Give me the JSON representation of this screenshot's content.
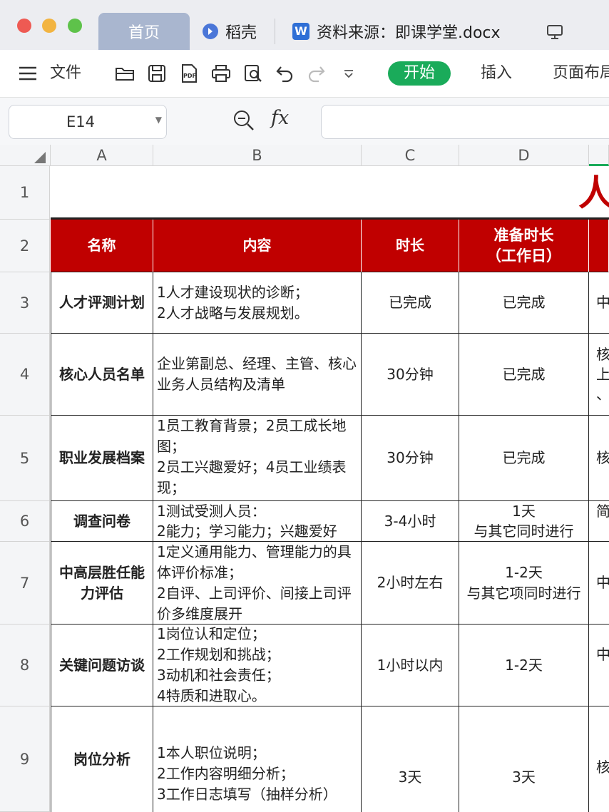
{
  "window": {
    "tabs": [
      {
        "label": "首页",
        "icon": "home"
      },
      {
        "label": "稻壳",
        "icon": "daoke-icon"
      },
      {
        "label": "资料来源：即课学堂.docx",
        "icon": "word-doc-icon"
      }
    ]
  },
  "toolbar": {
    "file_label": "文件",
    "start_label": "开始",
    "insert_label": "插入",
    "layout_label": "页面布局",
    "accent_color": "#1aab5a"
  },
  "formula_bar": {
    "cell_ref": "E14",
    "fx_label": "fx",
    "formula": ""
  },
  "sheet": {
    "columns": [
      "A",
      "B",
      "C",
      "D"
    ],
    "row_numbers": [
      "1",
      "2",
      "3",
      "4",
      "5",
      "6",
      "7",
      "8",
      "9"
    ],
    "title_fragment": "人",
    "header_color": "#c00000",
    "headers": [
      "名称",
      "内容",
      "时长",
      "准备时长\n（工作日）"
    ],
    "rows": [
      {
        "name": "人才评测计划",
        "content": "1人才建设现状的诊断；\n2人才战略与发展规划。",
        "duration": "已完成",
        "prep": "已完成",
        "e": "中"
      },
      {
        "name": "核心人员名单",
        "content": "企业第副总、经理、主管、核心业务人员结构及清单",
        "duration": "30分钟",
        "prep": "已完成",
        "e": "核\n上\n、"
      },
      {
        "name": "职业发展档案",
        "content": "1员工教育背景；2员工成长地图；\n2员工兴趣爱好；4员工业绩表现；",
        "duration": "30分钟",
        "prep": "已完成",
        "e": "核"
      },
      {
        "name": "调查问卷",
        "content": "1测试受测人员：\n2能力；学习能力；兴趣爱好",
        "duration": "3-4小时",
        "prep": "1天\n与其它同时进行",
        "e": "简"
      },
      {
        "name": "中高层胜任能力评估",
        "content": "1定义通用能力、管理能力的具体评价标准；\n2自评、上司评价、间接上司评价多维度展开",
        "duration": "2小时左右",
        "prep": "1-2天\n与其它项同时进行",
        "e": "中"
      },
      {
        "name": "关键问题访谈",
        "content": "1岗位认和定位；\n2工作规划和挑战；\n3动机和社会责任；\n4特质和进取心。",
        "duration": "1小时以内",
        "prep": "1-2天",
        "e": "中"
      },
      {
        "name": "岗位分析",
        "content": "1本人职位说明；\n2工作内容明细分析；\n3工作日志填写（抽样分析）",
        "duration": "3天",
        "prep": "3天",
        "e": "核"
      }
    ]
  }
}
